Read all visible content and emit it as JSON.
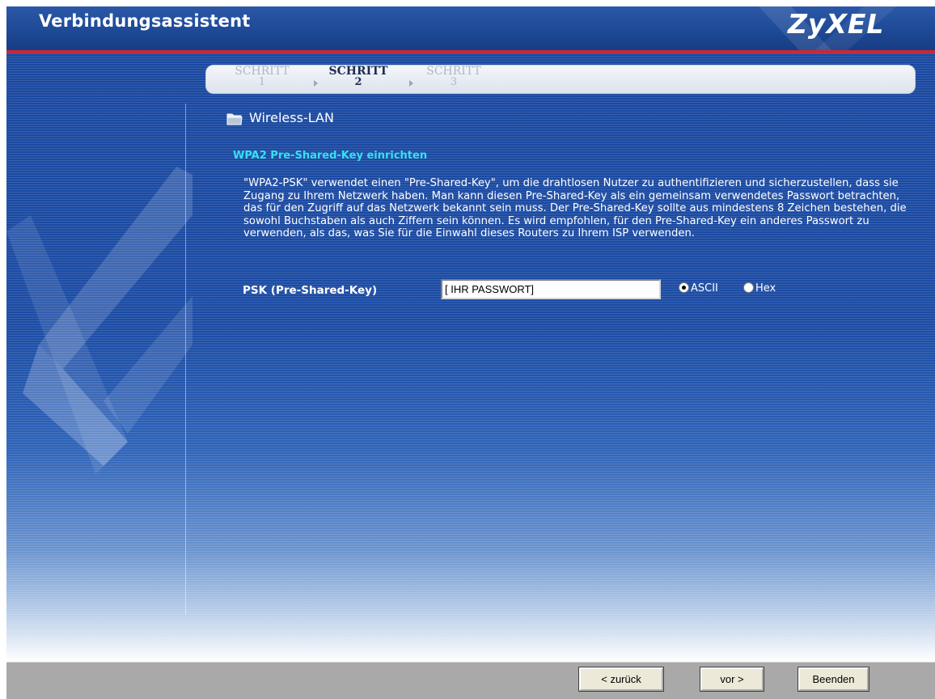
{
  "header": {
    "title": "Verbindungsassistent",
    "brand": "ZyXEL"
  },
  "steps": [
    {
      "label": "SCHRITT",
      "number": "1",
      "state": "done"
    },
    {
      "label": "SCHRITT",
      "number": "2",
      "state": "active"
    },
    {
      "label": "SCHRITT",
      "number": "3",
      "state": "pending"
    }
  ],
  "section": {
    "icon": "folder-icon",
    "title": "Wireless-LAN",
    "subtitle": "WPA2 Pre-Shared-Key einrichten",
    "description": "\"WPA2-PSK\" verwendet einen \"Pre-Shared-Key\", um die drahtlosen Nutzer zu authentifizieren und sicherzustellen, dass sie Zugang zu Ihrem Netzwerk haben. Man kann diesen Pre-Shared-Key als ein gemeinsam verwendetes Passwort betrachten, das für den Zugriff auf das Netzwerk bekannt sein muss. Der Pre-Shared-Key sollte aus mindestens 8 Zeichen bestehen, die sowohl Buchstaben als auch Ziffern sein können. Es wird empfohlen, für den Pre-Shared-Key ein anderes Passwort zu verwenden, als das, was Sie für die Einwahl dieses Routers zu Ihrem ISP verwenden."
  },
  "psk": {
    "label": "PSK (Pre-Shared-Key)",
    "value": "[ IHR PASSWORT]",
    "format_options": [
      "ASCII",
      "Hex"
    ],
    "selected_format": "ASCII"
  },
  "buttons": {
    "back": "< zurück",
    "next": "vor >",
    "finish": "Beenden"
  },
  "colors": {
    "header_bg": "#1d4894",
    "accent_line": "#c42a3a",
    "subtitle": "#38e0f0",
    "footer_bg": "#a9a9a9"
  }
}
